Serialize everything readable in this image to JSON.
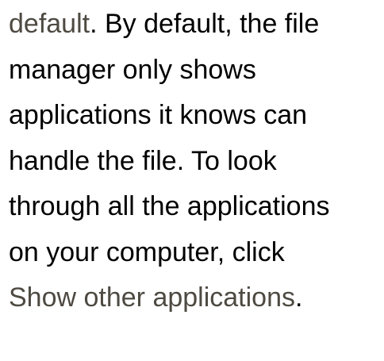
{
  "paragraph": {
    "line1": {
      "link": "default",
      "text": ". By default, the file"
    },
    "line2": "manager only shows",
    "line3": "applications it knows can",
    "line4": "handle the file. To look",
    "line5": "through all the applications",
    "line6": "on your computer, click",
    "line7": {
      "link": "Show other applications",
      "text": "."
    }
  },
  "colors": {
    "text": "#000000",
    "link": "#4e4a42",
    "background": "#ffffff"
  }
}
